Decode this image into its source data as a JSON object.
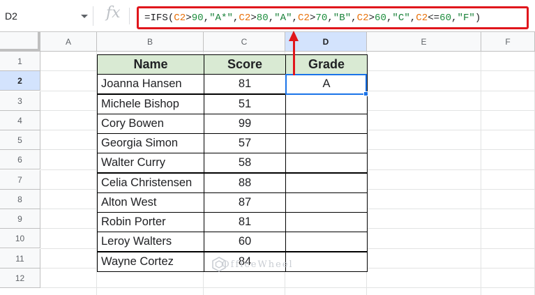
{
  "formula_bar": {
    "name_box": "D2",
    "fx_label": "fx",
    "formula_tokens": [
      {
        "text": "=IFS(",
        "kind": "op"
      },
      {
        "text": "C2",
        "kind": "ref"
      },
      {
        "text": ">",
        "kind": "op"
      },
      {
        "text": "90",
        "kind": "num"
      },
      {
        "text": ",",
        "kind": "op"
      },
      {
        "text": "\"A*\"",
        "kind": "str"
      },
      {
        "text": ",",
        "kind": "op"
      },
      {
        "text": "C2",
        "kind": "ref"
      },
      {
        "text": ">",
        "kind": "op"
      },
      {
        "text": "80",
        "kind": "num"
      },
      {
        "text": ",",
        "kind": "op"
      },
      {
        "text": "\"A\"",
        "kind": "str"
      },
      {
        "text": ",",
        "kind": "op"
      },
      {
        "text": "C2",
        "kind": "ref"
      },
      {
        "text": ">",
        "kind": "op"
      },
      {
        "text": "70",
        "kind": "num"
      },
      {
        "text": ",",
        "kind": "op"
      },
      {
        "text": "\"B\"",
        "kind": "str"
      },
      {
        "text": ",",
        "kind": "op"
      },
      {
        "text": "C2",
        "kind": "ref"
      },
      {
        "text": ">",
        "kind": "op"
      },
      {
        "text": "60",
        "kind": "num"
      },
      {
        "text": ",",
        "kind": "op"
      },
      {
        "text": "\"C\"",
        "kind": "str"
      },
      {
        "text": ",",
        "kind": "op"
      },
      {
        "text": "C2",
        "kind": "ref"
      },
      {
        "text": "<=",
        "kind": "op"
      },
      {
        "text": "60",
        "kind": "num"
      },
      {
        "text": ",",
        "kind": "op"
      },
      {
        "text": "\"F\"",
        "kind": "str"
      },
      {
        "text": ")",
        "kind": "op"
      }
    ]
  },
  "columns": [
    "A",
    "B",
    "C",
    "D",
    "E",
    "F"
  ],
  "selected_column": "D",
  "rows": [
    "1",
    "2",
    "3",
    "4",
    "5",
    "6",
    "7",
    "8",
    "9",
    "10",
    "11",
    "12"
  ],
  "selected_row": "2",
  "table": {
    "headers": [
      "Name",
      "Score",
      "Grade"
    ],
    "records": [
      {
        "name": "Joanna Hansen",
        "score": "81",
        "grade": "A"
      },
      {
        "name": "Michele Bishop",
        "score": "51",
        "grade": ""
      },
      {
        "name": "Cory Bowen",
        "score": "99",
        "grade": ""
      },
      {
        "name": "Georgia Simon",
        "score": "57",
        "grade": ""
      },
      {
        "name": "Walter Curry",
        "score": "58",
        "grade": ""
      },
      {
        "name": "Celia Christensen",
        "score": "88",
        "grade": ""
      },
      {
        "name": "Alton West",
        "score": "87",
        "grade": ""
      },
      {
        "name": "Robin Porter",
        "score": "81",
        "grade": ""
      },
      {
        "name": "Leroy Walters",
        "score": "60",
        "grade": ""
      },
      {
        "name": "Wayne Cortez",
        "score": "84",
        "grade": ""
      }
    ]
  },
  "watermark": "OfficeWheel",
  "colors": {
    "annotation_red": "#e0161c",
    "header_fill": "#d9ead3",
    "selection_blue": "#1a73e8",
    "cell_ref": "#e8710a",
    "number": "#1e8e3e",
    "string": "#188038"
  },
  "icons": {
    "name_box_dropdown": "chevron-down-icon",
    "arrow": "up-arrow-icon",
    "watermark_logo": "officewheel-logo-icon"
  }
}
